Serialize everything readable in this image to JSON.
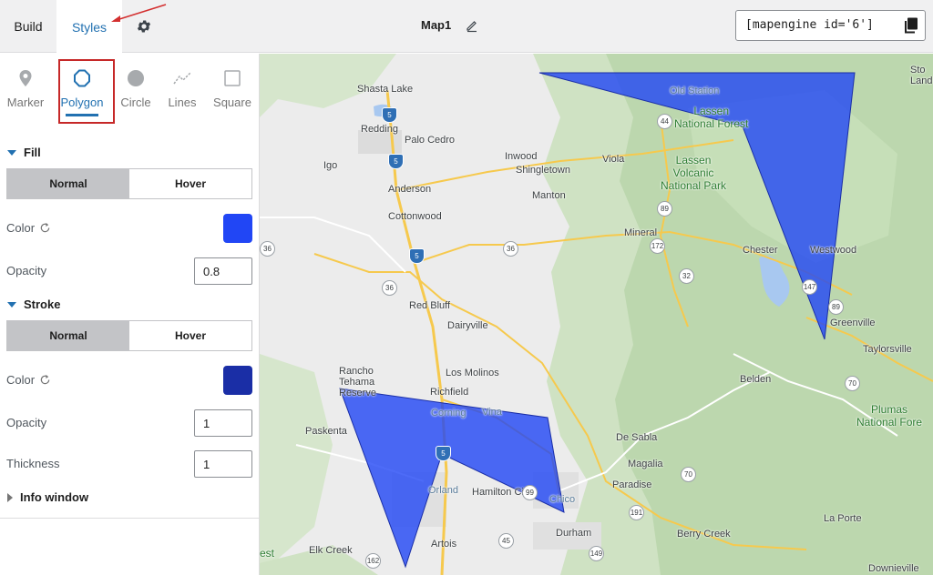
{
  "topbar": {
    "tabs": {
      "build": "Build",
      "styles": "Styles"
    },
    "map_title": "Map1",
    "shortcode": "[mapengine id='6']"
  },
  "sidebar": {
    "shape_tabs": [
      {
        "label": "Marker",
        "icon": "map-pin-icon"
      },
      {
        "label": "Polygon",
        "icon": "polygon-icon"
      },
      {
        "label": "Circle",
        "icon": "circle-icon"
      },
      {
        "label": "Lines",
        "icon": "lines-icon"
      },
      {
        "label": "Square",
        "icon": "square-icon"
      }
    ],
    "active_tab": "Polygon",
    "fill": {
      "title": "Fill",
      "toggle": {
        "normal": "Normal",
        "hover": "Hover",
        "selected": "Normal"
      },
      "color_label": "Color",
      "color": "#2146f5",
      "opacity_label": "Opacity",
      "opacity": "0.8"
    },
    "stroke": {
      "title": "Stroke",
      "toggle": {
        "normal": "Normal",
        "hover": "Hover",
        "selected": "Normal"
      },
      "color_label": "Color",
      "color": "#1a2ea6",
      "opacity_label": "Opacity",
      "opacity": "1",
      "thickness_label": "Thickness",
      "thickness": "1"
    },
    "info_window": {
      "title": "Info window"
    }
  },
  "map": {
    "places": {
      "shasta_lake": "Shasta Lake",
      "redding": "Redding",
      "palo_cedro": "Palo Cedro",
      "igo": "Igo",
      "inwood": "Inwood",
      "shingletown": "Shingletown",
      "viola": "Viola",
      "anderson": "Anderson",
      "manton": "Manton",
      "cottonwood": "Cottonwood",
      "mineral": "Mineral",
      "chester": "Chester",
      "westwood": "Westwood",
      "red_bluff": "Red Bluff",
      "dairyville": "Dairyville",
      "greenville": "Greenville",
      "taylorsville": "Taylorsville",
      "rancho_tehama": "Rancho\nTehama\nReserve",
      "los_molinos": "Los Molinos",
      "richfield": "Richfield",
      "belden": "Belden",
      "corning": "Corning",
      "vina": "Vina",
      "paskenta": "Paskenta",
      "de_sabla": "De Sabla",
      "magalia": "Magalia",
      "paradise": "Paradise",
      "orland": "Orland",
      "hamilton_city": "Hamilton City",
      "chico": "Chico",
      "durham": "Durham",
      "berry_creek": "Berry Creek",
      "la_porte": "La Porte",
      "elk_creek": "Elk Creek",
      "artois": "Artois",
      "downieville": "Downieville",
      "old_station": "Old Station",
      "lassen_nf": "Lassen\nNational Forest",
      "lassen_volcanic": "Lassen\nVolcanic\nNational Park",
      "plumas_nf": "Plumas\nNational Fore",
      "sto": "Sto\nLand",
      "est": "est"
    },
    "shields": [
      "5",
      "5",
      "5",
      "44",
      "89",
      "172",
      "36",
      "36",
      "36",
      "32",
      "147",
      "89",
      "70",
      "70",
      "191",
      "99",
      "45",
      "162",
      "149",
      "5"
    ]
  }
}
